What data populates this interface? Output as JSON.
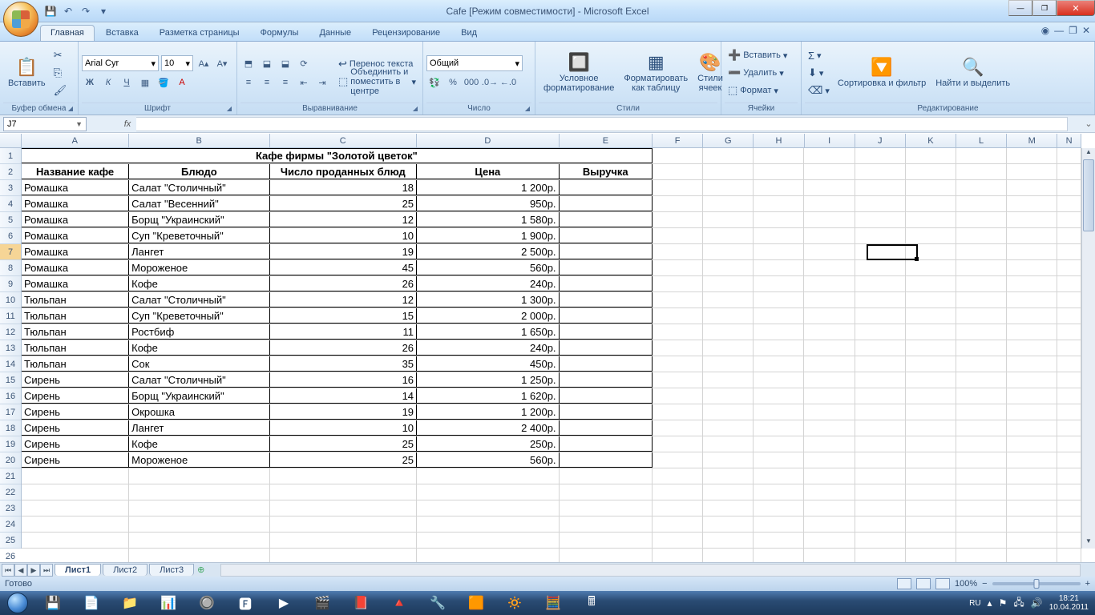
{
  "title": "Cafe  [Режим совместимости] - Microsoft Excel",
  "qat": {
    "save": "💾",
    "undo": "↶",
    "redo": "↷",
    "more": "▾"
  },
  "tabs": [
    "Главная",
    "Вставка",
    "Разметка страницы",
    "Формулы",
    "Данные",
    "Рецензирование",
    "Вид"
  ],
  "active_tab": 0,
  "ribbon": {
    "clipboard": {
      "label": "Буфер обмена",
      "paste": "Вставить"
    },
    "font": {
      "label": "Шрифт",
      "name": "Arial Cyr",
      "size": "10",
      "bold": "Ж",
      "italic": "К",
      "underline": "Ч"
    },
    "alignment": {
      "label": "Выравнивание",
      "wrap": "Перенос текста",
      "merge": "Объединить и поместить в центре"
    },
    "number": {
      "label": "Число",
      "format": "Общий"
    },
    "styles": {
      "label": "Стили",
      "cond": "Условное форматирование",
      "table": "Форматировать как таблицу",
      "cell": "Стили ячеек"
    },
    "cells": {
      "label": "Ячейки",
      "insert": "Вставить",
      "delete": "Удалить",
      "format": "Формат"
    },
    "editing": {
      "label": "Редактирование",
      "sort": "Сортировка и фильтр",
      "find": "Найти и выделить"
    }
  },
  "name_box": "J7",
  "columns": [
    {
      "l": "A",
      "w": 136
    },
    {
      "l": "B",
      "w": 178
    },
    {
      "l": "C",
      "w": 186
    },
    {
      "l": "D",
      "w": 180
    },
    {
      "l": "E",
      "w": 118
    },
    {
      "l": "F",
      "w": 64
    },
    {
      "l": "G",
      "w": 64
    },
    {
      "l": "H",
      "w": 64
    },
    {
      "l": "I",
      "w": 64
    },
    {
      "l": "J",
      "w": 64
    },
    {
      "l": "K",
      "w": 64
    },
    {
      "l": "L",
      "w": 64
    },
    {
      "l": "M",
      "w": 64
    },
    {
      "l": "N",
      "w": 30
    }
  ],
  "title_row": "Кафе фирмы \"Золотой цветок\"",
  "headers": [
    "Название кафе",
    "Блюдо",
    "Число проданных блюд",
    "Цена",
    "Выручка"
  ],
  "rows": [
    [
      "Ромашка",
      "Салат \"Столичный\"",
      "18",
      "1 200р.",
      ""
    ],
    [
      "Ромашка",
      "Салат \"Весенний\"",
      "25",
      "950р.",
      ""
    ],
    [
      "Ромашка",
      "Борщ \"Украинский\"",
      "12",
      "1 580р.",
      ""
    ],
    [
      "Ромашка",
      "Суп \"Креветочный\"",
      "10",
      "1 900р.",
      ""
    ],
    [
      "Ромашка",
      "Лангет",
      "19",
      "2 500р.",
      ""
    ],
    [
      "Ромашка",
      "Мороженое",
      "45",
      "560р.",
      ""
    ],
    [
      "Ромашка",
      "Кофе",
      "26",
      "240р.",
      ""
    ],
    [
      "Тюльпан",
      "Салат \"Столичный\"",
      "12",
      "1 300р.",
      ""
    ],
    [
      "Тюльпан",
      "Суп \"Креветочный\"",
      "15",
      "2 000р.",
      ""
    ],
    [
      "Тюльпан",
      "Ростбиф",
      "11",
      "1 650р.",
      ""
    ],
    [
      "Тюльпан",
      "Кофе",
      "26",
      "240р.",
      ""
    ],
    [
      "Тюльпан",
      "Сок",
      "35",
      "450р.",
      ""
    ],
    [
      "Сирень",
      "Салат \"Столичный\"",
      "16",
      "1 250р.",
      ""
    ],
    [
      "Сирень",
      "Борщ \"Украинский\"",
      "14",
      "1 620р.",
      ""
    ],
    [
      "Сирень",
      "Окрошка",
      "19",
      "1 200р.",
      ""
    ],
    [
      "Сирень",
      "Лангет",
      "10",
      "2 400р.",
      ""
    ],
    [
      "Сирень",
      "Кофе",
      "25",
      "250р.",
      ""
    ],
    [
      "Сирень",
      "Мороженое",
      "25",
      "560р.",
      ""
    ]
  ],
  "empty_rows": 6,
  "sheets": [
    "Лист1",
    "Лист2",
    "Лист3"
  ],
  "active_sheet": 0,
  "status": "Готово",
  "zoom": "100%",
  "tray": {
    "lang": "RU",
    "time": "18:21",
    "date": "10.04.2011"
  },
  "task_icons": [
    "💾",
    "📄",
    "📁",
    "📊",
    "🔘",
    "🅵",
    "▶",
    "🎬",
    "📕",
    "🔺",
    "🔧",
    "🟧",
    "🔅",
    "🧮",
    "🖩"
  ]
}
